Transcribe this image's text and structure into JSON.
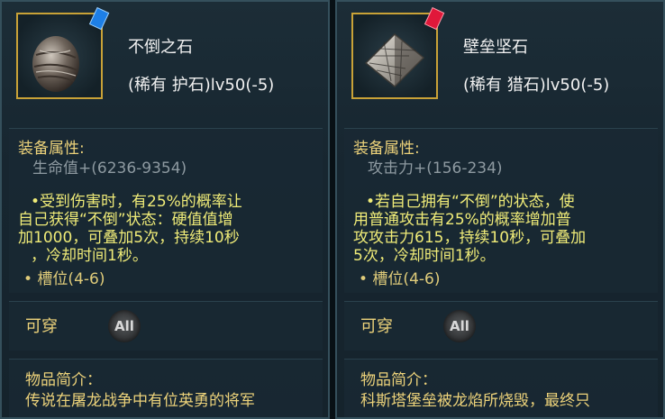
{
  "left": {
    "name": "不倒之石",
    "rarity": "(稀有 护石)lv50(-5)",
    "attr_label": "装备属性:",
    "attr_value": "生命值+(6236-9354)",
    "desc": [
      "•受到伤害时，有25%的概率让",
      "自己获得“不倒”状态：硬值值增",
      "加1000，可叠加5次，持续10秒",
      "，冷却时间1秒。"
    ],
    "slot": "• 槽位(4-6)",
    "wearable": "可穿",
    "class_badge": "All",
    "intro_label": "物品简介：",
    "intro_text": "传说在屠龙战争中有位英勇的将军"
  },
  "right": {
    "name": "壁垒坚石",
    "rarity": "(稀有 猎石)lv50(-5)",
    "attr_label": "装备属性:",
    "attr_value": "攻击力+(156-234)",
    "desc": [
      "•若自己拥有“不倒”的状态，使",
      "用普通攻击有25%的概率增加普",
      "攻攻击力615，持续10秒，可叠加",
      "5次，冷却时间1秒。"
    ],
    "slot": "• 槽位(4-6)",
    "wearable": "可穿",
    "class_badge": "All",
    "intro_label": "物品简介：",
    "intro_text": "科斯塔堡垒被龙焰所烧毁，最终只"
  }
}
